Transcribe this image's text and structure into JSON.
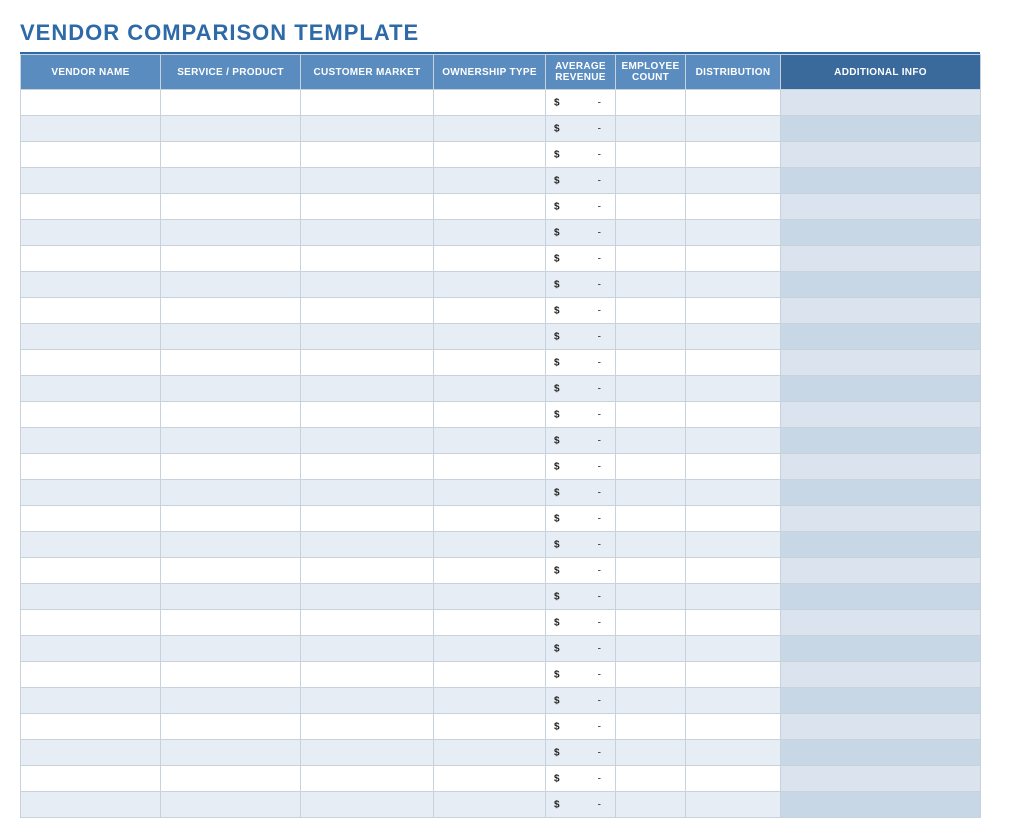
{
  "title": "VENDOR COMPARISON TEMPLATE",
  "columns": [
    "VENDOR NAME",
    "SERVICE / PRODUCT",
    "CUSTOMER MARKET",
    "OWNERSHIP TYPE",
    "AVERAGE REVENUE",
    "EMPLOYEE COUNT",
    "DISTRIBUTION",
    "ADDITIONAL INFO"
  ],
  "revenue_symbol": "$",
  "revenue_empty": "-",
  "row_count": 28
}
